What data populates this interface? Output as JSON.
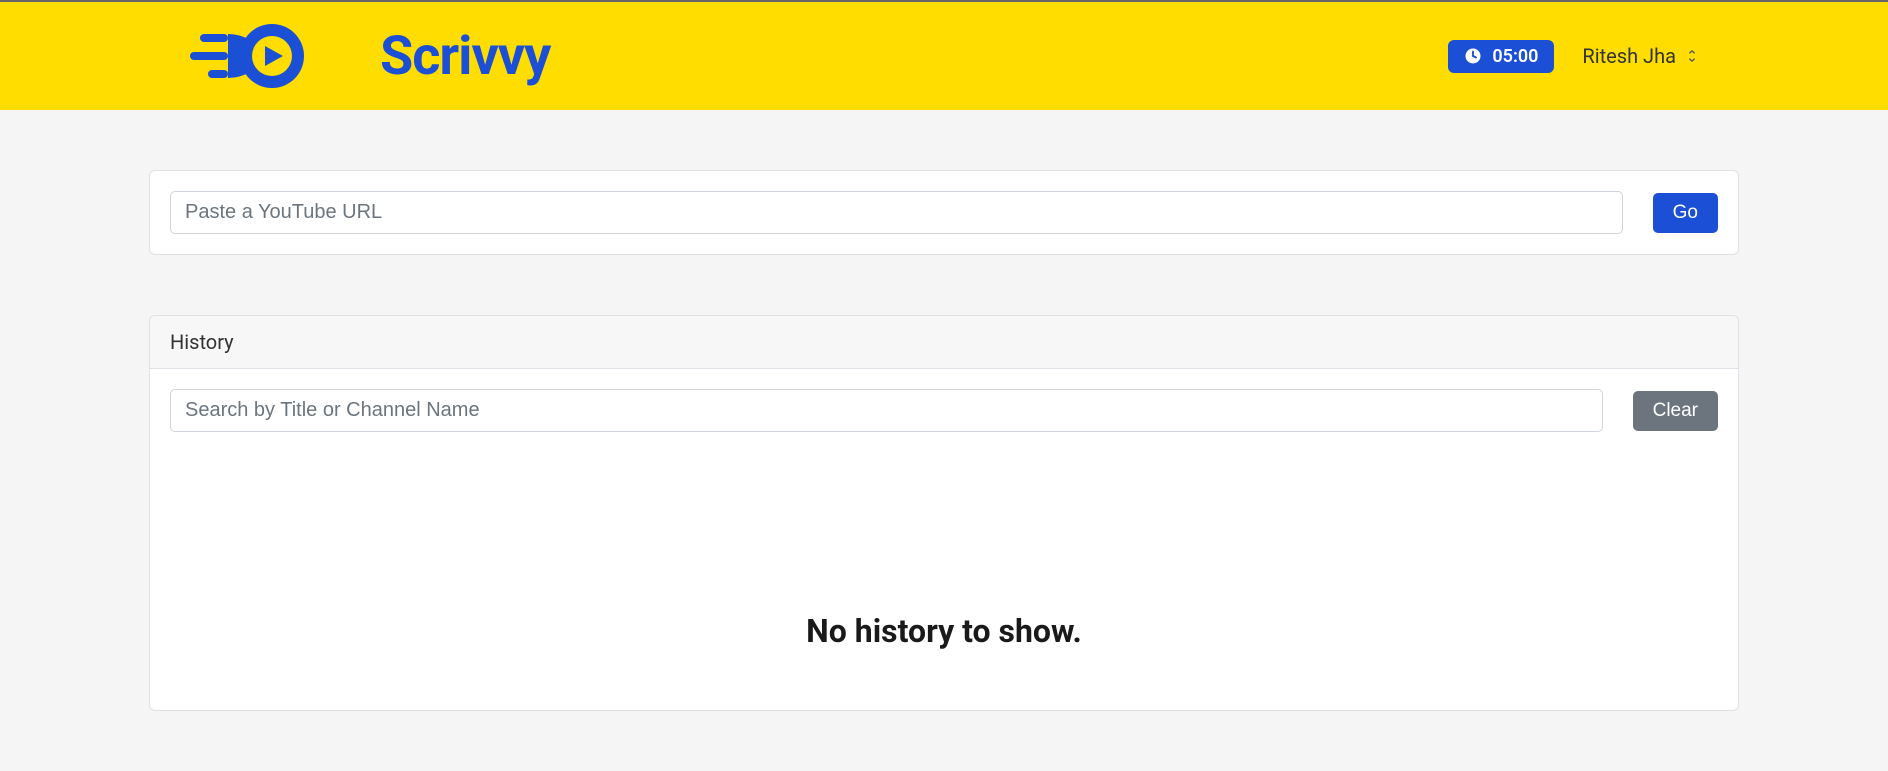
{
  "header": {
    "brand_text": "Scrivvy",
    "timer_value": "05:00",
    "user_name": "Ritesh Jha"
  },
  "url_form": {
    "placeholder": "Paste a YouTube URL",
    "value": "",
    "go_button": "Go"
  },
  "history": {
    "title": "History",
    "search_placeholder": "Search by Title or Channel Name",
    "search_value": "",
    "clear_button": "Clear",
    "empty_message": "No history to show."
  }
}
